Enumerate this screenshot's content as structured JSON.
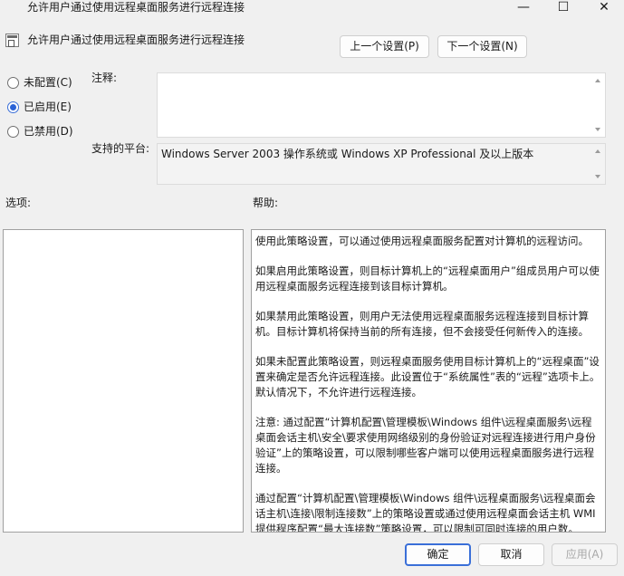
{
  "window": {
    "title": "允许用户通过使用远程桌面服务进行远程连接",
    "minimize_glyph": "—",
    "maximize_glyph": "☐",
    "close_glyph": "✕"
  },
  "policy": {
    "name": "允许用户通过使用远程桌面服务进行远程连接",
    "icon": "policy-setting-icon"
  },
  "nav": {
    "prev_label": "上一个设置(P)",
    "next_label": "下一个设置(N)"
  },
  "state_options": [
    {
      "label": "未配置(C)",
      "checked": false
    },
    {
      "label": "已启用(E)",
      "checked": true
    },
    {
      "label": "已禁用(D)",
      "checked": false
    }
  ],
  "comment": {
    "label": "注释:",
    "value": ""
  },
  "platform": {
    "label": "支持的平台:",
    "value": "Windows Server 2003 操作系统或 Windows XP Professional 及以上版本"
  },
  "options": {
    "label": "选项:"
  },
  "help": {
    "label": "帮助:",
    "paragraphs": [
      "使用此策略设置，可以通过使用远程桌面服务配置对计算机的远程访问。",
      "如果启用此策略设置，则目标计算机上的“远程桌面用户”组成员用户可以使用远程桌面服务远程连接到该目标计算机。",
      "如果禁用此策略设置，则用户无法使用远程桌面服务远程连接到目标计算机。目标计算机将保持当前的所有连接，但不会接受任何新传入的连接。",
      "如果未配置此策略设置，则远程桌面服务使用目标计算机上的“远程桌面”设置来确定是否允许远程连接。此设置位于“系统属性”表的“远程”选项卡上。默认情况下，不允许进行远程连接。",
      "注意: 通过配置“计算机配置\\管理模板\\Windows 组件\\远程桌面服务\\远程桌面会话主机\\安全\\要求使用网络级别的身份验证对远程连接进行用户身份验证”上的策略设置，可以限制哪些客户端可以使用远程桌面服务进行远程连接。",
      "通过配置“计算机配置\\管理模板\\Windows 组件\\远程桌面服务\\远程桌面会话主机\\连接\\限制连接数”上的策略设置或通过使用远程桌面会话主机 WMI 提供程序配置“最大连接数”策略设置，可以限制可同时连接的用户数。"
    ]
  },
  "footer": {
    "ok_label": "确定",
    "cancel_label": "取消",
    "apply_label": "应用(A)"
  }
}
